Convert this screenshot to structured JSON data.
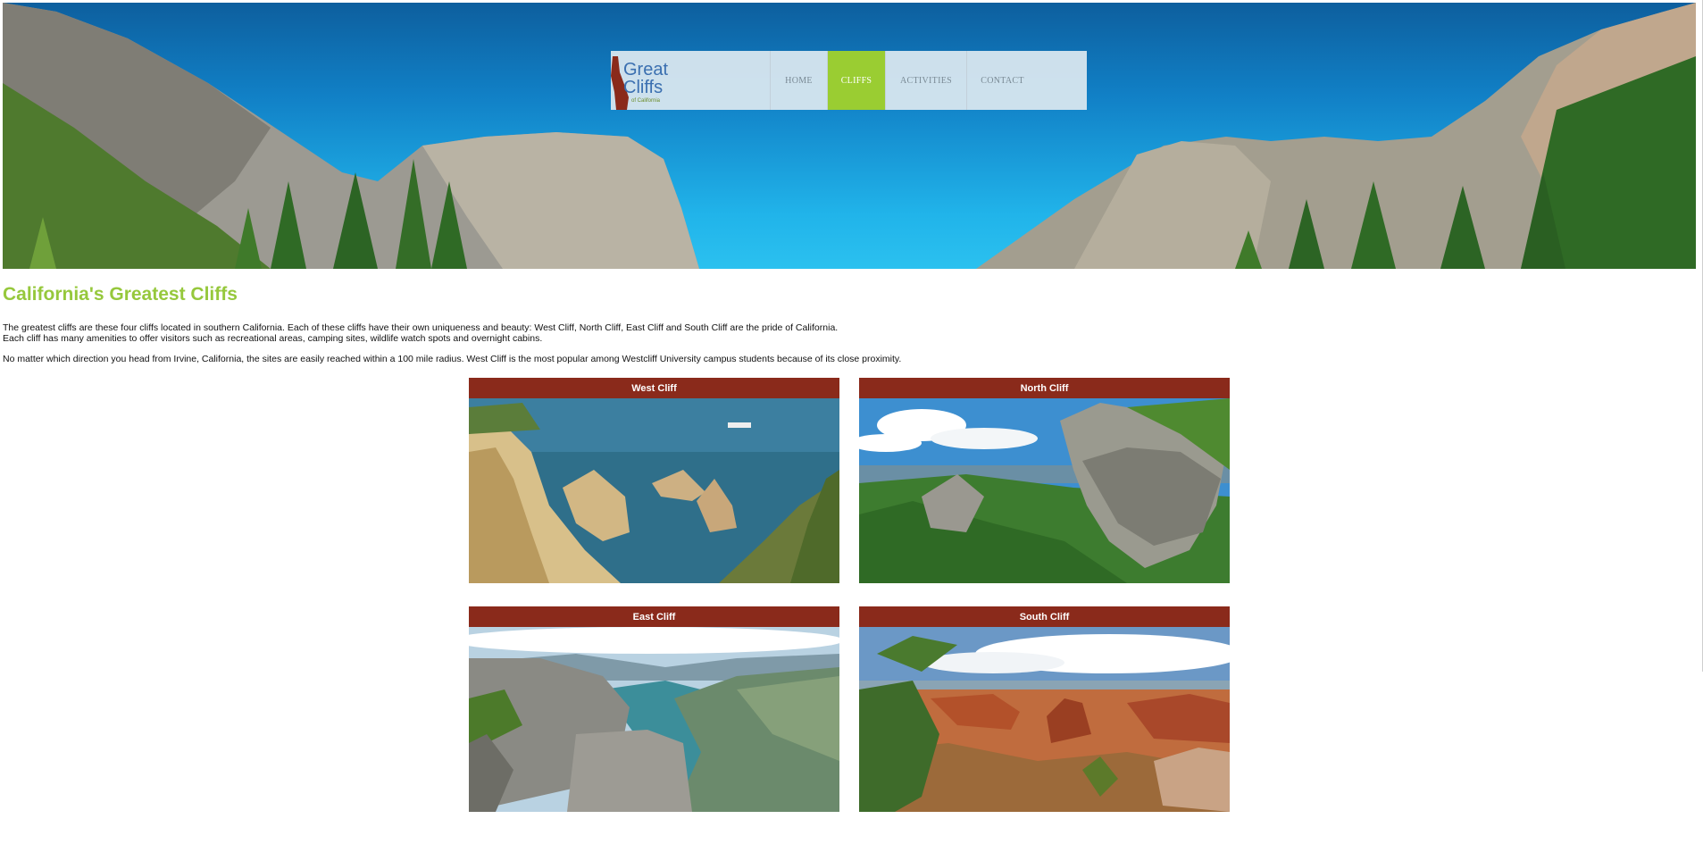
{
  "site": {
    "logo": {
      "line1": "Great",
      "line2": "Cliffs",
      "line3": "of California"
    },
    "nav": [
      {
        "label": "HOME",
        "active": false
      },
      {
        "label": "CLIFFS",
        "active": true
      },
      {
        "label": "ACTIVITIES",
        "active": false
      },
      {
        "label": "CONTACT",
        "active": false
      }
    ]
  },
  "main": {
    "title": "California's Greatest Cliffs",
    "paragraph1_line1": "The greatest cliffs are these four cliffs located in southern California. Each of these cliffs have their own uniqueness and beauty: West Cliff, North Cliff, East Cliff and South Cliff are the pride of California.",
    "paragraph1_line2": "Each cliff has many amenities to offer visitors such as recreational areas, camping sites, wildlife watch spots and overnight cabins.",
    "paragraph2": "No matter which direction you head from Irvine, California, the sites are easily reached within a 100 mile radius. West Cliff is the most popular among Westcliff University campus students because of its close proximity."
  },
  "cliffs": [
    {
      "name": "West Cliff"
    },
    {
      "name": "North Cliff"
    },
    {
      "name": "East Cliff"
    },
    {
      "name": "South Cliff"
    }
  ],
  "colors": {
    "accent_green": "#9acd32",
    "title_green": "#96c83c",
    "card_header": "#8a2a1b",
    "nav_bg": "#dce8f0"
  }
}
